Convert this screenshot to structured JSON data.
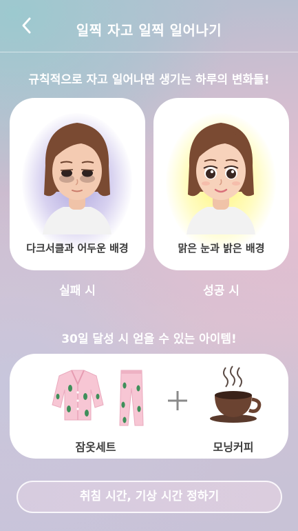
{
  "header": {
    "title": "일찍 자고 일찍 일어나기",
    "back_icon": "chevron-left-icon"
  },
  "intro": {
    "subtitle": "규칙적으로 자고 일어나면 생기는 하루의 변화들!"
  },
  "comparison": {
    "fail": {
      "caption": "다크서클과 어두운 배경",
      "result": "실패 시",
      "background_color": "#b4a8e0"
    },
    "success": {
      "caption": "맑은 눈과 밝은 배경",
      "result": "성공 시",
      "background_color": "#fff27a"
    }
  },
  "rewards": {
    "title": "30일 달성 시 얻을 수 있는 아이템!",
    "items": [
      {
        "label": "잠옷세트",
        "icon": "pajama-set-icon"
      },
      {
        "label": "모닝커피",
        "icon": "coffee-cup-icon"
      }
    ],
    "plus_icon": "plus-icon"
  },
  "cta": {
    "label": "취침 시간, 기상 시간 정하기"
  }
}
